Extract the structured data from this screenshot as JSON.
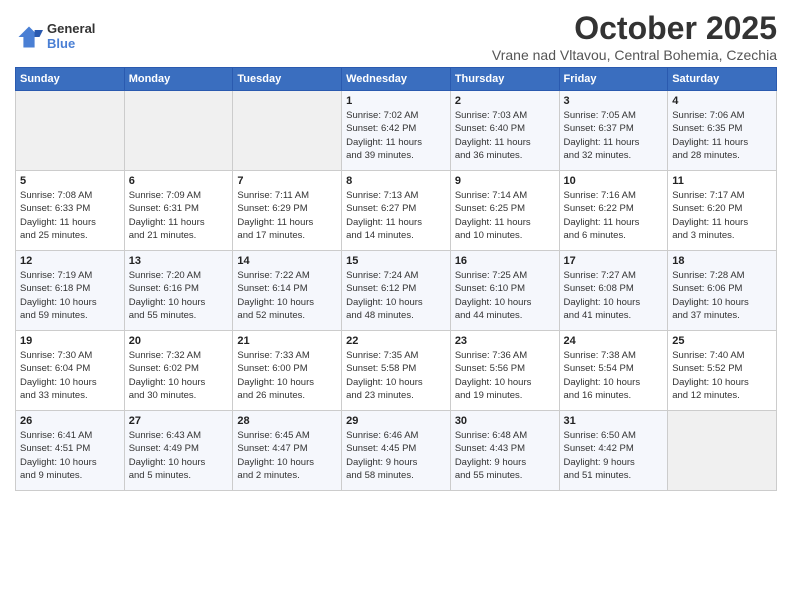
{
  "header": {
    "logo_line1": "General",
    "logo_line2": "Blue",
    "month_title": "October 2025",
    "location": "Vrane nad Vltavou, Central Bohemia, Czechia"
  },
  "weekdays": [
    "Sunday",
    "Monday",
    "Tuesday",
    "Wednesday",
    "Thursday",
    "Friday",
    "Saturday"
  ],
  "weeks": [
    [
      {
        "day": "",
        "info": ""
      },
      {
        "day": "",
        "info": ""
      },
      {
        "day": "",
        "info": ""
      },
      {
        "day": "1",
        "info": "Sunrise: 7:02 AM\nSunset: 6:42 PM\nDaylight: 11 hours\nand 39 minutes."
      },
      {
        "day": "2",
        "info": "Sunrise: 7:03 AM\nSunset: 6:40 PM\nDaylight: 11 hours\nand 36 minutes."
      },
      {
        "day": "3",
        "info": "Sunrise: 7:05 AM\nSunset: 6:37 PM\nDaylight: 11 hours\nand 32 minutes."
      },
      {
        "day": "4",
        "info": "Sunrise: 7:06 AM\nSunset: 6:35 PM\nDaylight: 11 hours\nand 28 minutes."
      }
    ],
    [
      {
        "day": "5",
        "info": "Sunrise: 7:08 AM\nSunset: 6:33 PM\nDaylight: 11 hours\nand 25 minutes."
      },
      {
        "day": "6",
        "info": "Sunrise: 7:09 AM\nSunset: 6:31 PM\nDaylight: 11 hours\nand 21 minutes."
      },
      {
        "day": "7",
        "info": "Sunrise: 7:11 AM\nSunset: 6:29 PM\nDaylight: 11 hours\nand 17 minutes."
      },
      {
        "day": "8",
        "info": "Sunrise: 7:13 AM\nSunset: 6:27 PM\nDaylight: 11 hours\nand 14 minutes."
      },
      {
        "day": "9",
        "info": "Sunrise: 7:14 AM\nSunset: 6:25 PM\nDaylight: 11 hours\nand 10 minutes."
      },
      {
        "day": "10",
        "info": "Sunrise: 7:16 AM\nSunset: 6:22 PM\nDaylight: 11 hours\nand 6 minutes."
      },
      {
        "day": "11",
        "info": "Sunrise: 7:17 AM\nSunset: 6:20 PM\nDaylight: 11 hours\nand 3 minutes."
      }
    ],
    [
      {
        "day": "12",
        "info": "Sunrise: 7:19 AM\nSunset: 6:18 PM\nDaylight: 10 hours\nand 59 minutes."
      },
      {
        "day": "13",
        "info": "Sunrise: 7:20 AM\nSunset: 6:16 PM\nDaylight: 10 hours\nand 55 minutes."
      },
      {
        "day": "14",
        "info": "Sunrise: 7:22 AM\nSunset: 6:14 PM\nDaylight: 10 hours\nand 52 minutes."
      },
      {
        "day": "15",
        "info": "Sunrise: 7:24 AM\nSunset: 6:12 PM\nDaylight: 10 hours\nand 48 minutes."
      },
      {
        "day": "16",
        "info": "Sunrise: 7:25 AM\nSunset: 6:10 PM\nDaylight: 10 hours\nand 44 minutes."
      },
      {
        "day": "17",
        "info": "Sunrise: 7:27 AM\nSunset: 6:08 PM\nDaylight: 10 hours\nand 41 minutes."
      },
      {
        "day": "18",
        "info": "Sunrise: 7:28 AM\nSunset: 6:06 PM\nDaylight: 10 hours\nand 37 minutes."
      }
    ],
    [
      {
        "day": "19",
        "info": "Sunrise: 7:30 AM\nSunset: 6:04 PM\nDaylight: 10 hours\nand 33 minutes."
      },
      {
        "day": "20",
        "info": "Sunrise: 7:32 AM\nSunset: 6:02 PM\nDaylight: 10 hours\nand 30 minutes."
      },
      {
        "day": "21",
        "info": "Sunrise: 7:33 AM\nSunset: 6:00 PM\nDaylight: 10 hours\nand 26 minutes."
      },
      {
        "day": "22",
        "info": "Sunrise: 7:35 AM\nSunset: 5:58 PM\nDaylight: 10 hours\nand 23 minutes."
      },
      {
        "day": "23",
        "info": "Sunrise: 7:36 AM\nSunset: 5:56 PM\nDaylight: 10 hours\nand 19 minutes."
      },
      {
        "day": "24",
        "info": "Sunrise: 7:38 AM\nSunset: 5:54 PM\nDaylight: 10 hours\nand 16 minutes."
      },
      {
        "day": "25",
        "info": "Sunrise: 7:40 AM\nSunset: 5:52 PM\nDaylight: 10 hours\nand 12 minutes."
      }
    ],
    [
      {
        "day": "26",
        "info": "Sunrise: 6:41 AM\nSunset: 4:51 PM\nDaylight: 10 hours\nand 9 minutes."
      },
      {
        "day": "27",
        "info": "Sunrise: 6:43 AM\nSunset: 4:49 PM\nDaylight: 10 hours\nand 5 minutes."
      },
      {
        "day": "28",
        "info": "Sunrise: 6:45 AM\nSunset: 4:47 PM\nDaylight: 10 hours\nand 2 minutes."
      },
      {
        "day": "29",
        "info": "Sunrise: 6:46 AM\nSunset: 4:45 PM\nDaylight: 9 hours\nand 58 minutes."
      },
      {
        "day": "30",
        "info": "Sunrise: 6:48 AM\nSunset: 4:43 PM\nDaylight: 9 hours\nand 55 minutes."
      },
      {
        "day": "31",
        "info": "Sunrise: 6:50 AM\nSunset: 4:42 PM\nDaylight: 9 hours\nand 51 minutes."
      },
      {
        "day": "",
        "info": ""
      }
    ]
  ]
}
